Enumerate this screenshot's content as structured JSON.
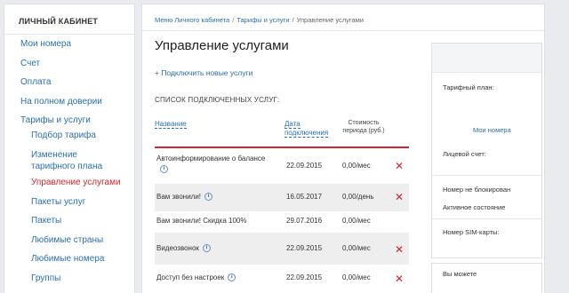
{
  "sidebar": {
    "title": "ЛИЧНЫЙ КАБИНЕТ",
    "items": [
      {
        "label": "Мои номера"
      },
      {
        "label": "Счет"
      },
      {
        "label": "Оплата"
      },
      {
        "label": "На полном доверии"
      },
      {
        "label": "Тарифы и услуги"
      }
    ],
    "subitems": [
      {
        "label": "Подбор тарифа"
      },
      {
        "label": "Изменение тарифного плана"
      },
      {
        "label": "Управление услугами",
        "active": true
      },
      {
        "label": "Пакеты услуг"
      },
      {
        "label": "Пакеты"
      },
      {
        "label": "Любимые страны"
      },
      {
        "label": "Любимые номера"
      },
      {
        "label": "Группы"
      }
    ]
  },
  "breadcrumb": {
    "items": [
      "Меню Личного кабинета",
      "Тарифы и услуги",
      "Управление услугами"
    ],
    "separator": "/"
  },
  "main": {
    "title": "Управление услугами",
    "add_link": "+ Подключить новые услуги",
    "list_heading": "СПИСОК ПОДКЛЮЧЕННЫХ УСЛУГ:",
    "columns": {
      "name": "Название",
      "date_line1": "Дата",
      "date_line2": "подключения",
      "cost_line1": "Стоимость",
      "cost_line2": "периода (руб.)"
    },
    "rows": [
      {
        "name": "Автоинформирование о балансе",
        "date": "22.09.2015",
        "cost": "0,00/мес",
        "info": true,
        "deletable": true
      },
      {
        "name": "Вам звонили!",
        "date": "16.05.2017",
        "cost": "0,00/день",
        "info": true,
        "deletable": true
      },
      {
        "name": "Вам звонили! Скидка 100%",
        "date": "29.07.2016",
        "cost": "0,00/мес",
        "info": false,
        "deletable": false
      },
      {
        "name": "Видеозвонок",
        "date": "22.09.2015",
        "cost": "0,00/мес",
        "info": true,
        "deletable": true
      },
      {
        "name": "Доступ без настроек",
        "date": "22.09.2015",
        "cost": "0,00/мес",
        "info": true,
        "deletable": true
      }
    ]
  },
  "info_panel": {
    "tariff_label": "Тарифный план:",
    "numbers_link": "Мои номера",
    "account_label": "Лицевой счет:",
    "status": "Номер не блокирован",
    "state": "Активное состояние",
    "sim_label": "Номер SIM-карты:",
    "can_label": "Вы можете"
  },
  "icons": {
    "info": "info-icon",
    "delete": "delete-icon"
  },
  "colors": {
    "link": "#2a70b0",
    "active": "#d0262d",
    "accent_rule": "#d0262d",
    "row_shade": "#eeeeee"
  }
}
